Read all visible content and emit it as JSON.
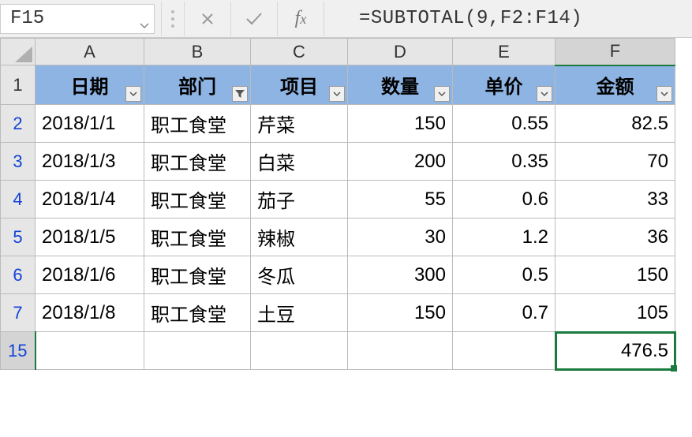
{
  "formula_bar": {
    "cell_ref": "F15",
    "formula": "=SUBTOTAL(9,F2:F14)"
  },
  "columns": [
    "A",
    "B",
    "C",
    "D",
    "E",
    "F"
  ],
  "visible_row_numbers": [
    1,
    2,
    3,
    4,
    5,
    6,
    7,
    15
  ],
  "headers": {
    "A": "日期",
    "B": "部门",
    "C": "项目",
    "D": "数量",
    "E": "单价",
    "F": "金额"
  },
  "rows": [
    {
      "r": "2",
      "A": "2018/1/1",
      "B": "职工食堂",
      "C": "芹菜",
      "D": "150",
      "E": "0.55",
      "F": "82.5"
    },
    {
      "r": "3",
      "A": "2018/1/3",
      "B": "职工食堂",
      "C": "白菜",
      "D": "200",
      "E": "0.35",
      "F": "70"
    },
    {
      "r": "4",
      "A": "2018/1/4",
      "B": "职工食堂",
      "C": "茄子",
      "D": "55",
      "E": "0.6",
      "F": "33"
    },
    {
      "r": "5",
      "A": "2018/1/5",
      "B": "职工食堂",
      "C": "辣椒",
      "D": "30",
      "E": "1.2",
      "F": "36"
    },
    {
      "r": "6",
      "A": "2018/1/6",
      "B": "职工食堂",
      "C": "冬瓜",
      "D": "300",
      "E": "0.5",
      "F": "150"
    },
    {
      "r": "7",
      "A": "2018/1/8",
      "B": "职工食堂",
      "C": "土豆",
      "D": "150",
      "E": "0.7",
      "F": "105"
    }
  ],
  "totals_row": {
    "r": "15",
    "F": "476.5"
  },
  "filtered_column": "B",
  "selected_cell": "F15"
}
